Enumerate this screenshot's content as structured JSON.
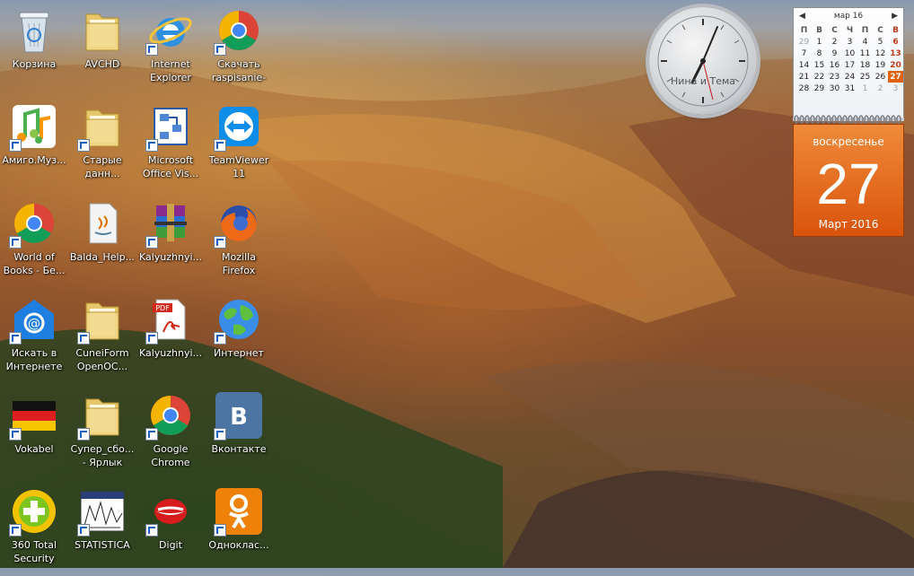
{
  "icons": [
    {
      "label": "Корзина",
      "icon": "recycle-bin-icon",
      "shortcut": false
    },
    {
      "label": "AVCHD",
      "icon": "folder-icon",
      "shortcut": false
    },
    {
      "label": "Internet\nExplorer",
      "icon": "internet-explorer-icon",
      "shortcut": true
    },
    {
      "label": "Скачать\nraspisanie-e...",
      "icon": "chrome-icon",
      "shortcut": true
    },
    {
      "label": "Амиго.Муз...",
      "icon": "music-note-icon",
      "shortcut": true
    },
    {
      "label": "Старые\nданн...",
      "icon": "folder-icon",
      "shortcut": true
    },
    {
      "label": "Microsoft\nOffice Vis...",
      "icon": "visio-icon",
      "shortcut": true
    },
    {
      "label": "TeamViewer\n11",
      "icon": "teamviewer-icon",
      "shortcut": true
    },
    {
      "label": "World of\nBooks - Бе...",
      "icon": "chrome-icon",
      "shortcut": true
    },
    {
      "label": "Balda_Help...",
      "icon": "java-file-icon",
      "shortcut": false
    },
    {
      "label": "Kalyuzhnyi...",
      "icon": "winrar-icon",
      "shortcut": true
    },
    {
      "label": "Mozilla\nFirefox",
      "icon": "firefox-icon",
      "shortcut": true
    },
    {
      "label": "Искать в\nИнтернете",
      "icon": "mail-search-icon",
      "shortcut": true
    },
    {
      "label": "CuneiForm\nOpenOC...",
      "icon": "folder-icon",
      "shortcut": true
    },
    {
      "label": "Kalyuzhnyi...",
      "icon": "pdf-icon",
      "shortcut": true
    },
    {
      "label": "Интернет",
      "icon": "globe-icon",
      "shortcut": true
    },
    {
      "label": "Vokabel",
      "icon": "german-flag-icon",
      "shortcut": true
    },
    {
      "label": "Супер_сбо...\n- Ярлык",
      "icon": "folder-icon",
      "shortcut": true
    },
    {
      "label": "Google\nChrome",
      "icon": "chrome-icon",
      "shortcut": true
    },
    {
      "label": "Вконтакте",
      "icon": "vk-icon",
      "shortcut": true
    },
    {
      "label": "360 Total\nSecurity",
      "icon": "security-plus-icon",
      "shortcut": true
    },
    {
      "label": "STATISTICA",
      "icon": "statistica-icon",
      "shortcut": true
    },
    {
      "label": "Digit",
      "icon": "digit-lips-icon",
      "shortcut": true
    },
    {
      "label": "Одноклас...",
      "icon": "odnoklassniki-icon",
      "shortcut": true
    }
  ],
  "clock": {
    "caption": "Нина и Тема"
  },
  "calendar": {
    "month_label": "мар 16",
    "prev_glyph": "◀",
    "next_glyph": "▶",
    "weekdays": [
      "П",
      "В",
      "С",
      "Ч",
      "П",
      "С",
      "В"
    ],
    "weeks": [
      [
        "29",
        "1",
        "2",
        "3",
        "4",
        "5",
        "6"
      ],
      [
        "7",
        "8",
        "9",
        "10",
        "11",
        "12",
        "13"
      ],
      [
        "14",
        "15",
        "16",
        "17",
        "18",
        "19",
        "20"
      ],
      [
        "21",
        "22",
        "23",
        "24",
        "25",
        "26",
        "27"
      ],
      [
        "28",
        "29",
        "30",
        "31",
        "1",
        "2",
        "3"
      ]
    ],
    "weekday_name": "воскресенье",
    "day_number": "27",
    "month_year": "Март 2016",
    "accent": "#e0620f"
  }
}
